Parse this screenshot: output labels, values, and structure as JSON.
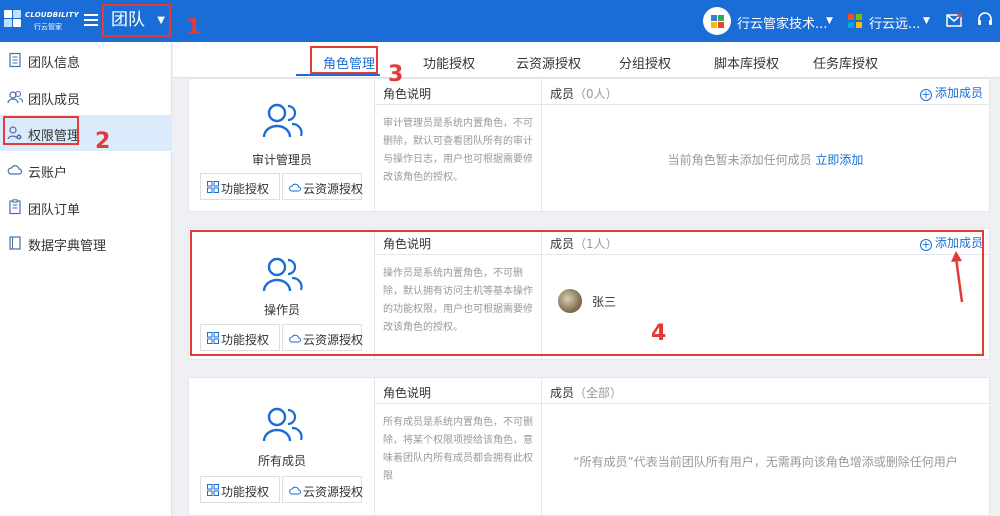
{
  "header": {
    "logo_name": "CLOUDBILITY",
    "logo_sub": "行云管家",
    "team_selector": "团队",
    "org_name": "行云管家技术...",
    "region_name": "行云远..."
  },
  "sidebar": {
    "items": [
      {
        "label": "团队信息",
        "icon": "document-icon"
      },
      {
        "label": "团队成员",
        "icon": "users-icon"
      },
      {
        "label": "权限管理",
        "icon": "user-gear-icon"
      },
      {
        "label": "云账户",
        "icon": "cloud-icon"
      },
      {
        "label": "团队订单",
        "icon": "order-icon"
      },
      {
        "label": "数据字典管理",
        "icon": "book-icon"
      }
    ],
    "active_index": 2
  },
  "tabs": [
    {
      "label": "角色管理"
    },
    {
      "label": "功能授权"
    },
    {
      "label": "云资源授权"
    },
    {
      "label": "分组授权"
    },
    {
      "label": "脚本库授权"
    },
    {
      "label": "任务库授权"
    }
  ],
  "roles": [
    {
      "name": "审计管理员",
      "desc_head": "角色说明",
      "description": "审计管理员是系统内置角色，不可删除，默认可查看团队所有的审计与操作日志，用户也可根据需要修改该角色的授权。",
      "members_head": "成员",
      "members_count": "（0人）",
      "add_member": "添加成员",
      "empty_text": "当前角色暂未添加任何成员",
      "empty_link": "立即添加",
      "btn_func": "功能授权",
      "btn_cloud": "云资源授权"
    },
    {
      "name": "操作员",
      "desc_head": "角色说明",
      "description": "操作员是系统内置角色，不可删除，默认拥有访问主机等基本操作的功能权限，用户也可根据需要修改该角色的授权。",
      "members_head": "成员",
      "members_count": "（1人）",
      "add_member": "添加成员",
      "member_name": "张三",
      "btn_func": "功能授权",
      "btn_cloud": "云资源授权"
    },
    {
      "name": "所有成员",
      "desc_head": "角色说明",
      "description": "所有成员是系统内置角色，不可删除，将某个权限项授给该角色，意味着团队内所有成员都会拥有此权限",
      "members_head": "成员",
      "members_count": "（全部）",
      "empty_text": "“所有成员”代表当前团队所有用户，无需再向该角色增添或删除任何用户",
      "btn_func": "功能授权",
      "btn_cloud": "云资源授权"
    }
  ],
  "annotations": [
    "1",
    "2",
    "3",
    "4"
  ],
  "colors": {
    "primary": "#1a6dd6",
    "annotation": "#e53935",
    "active_bg": "#dcebfb"
  }
}
